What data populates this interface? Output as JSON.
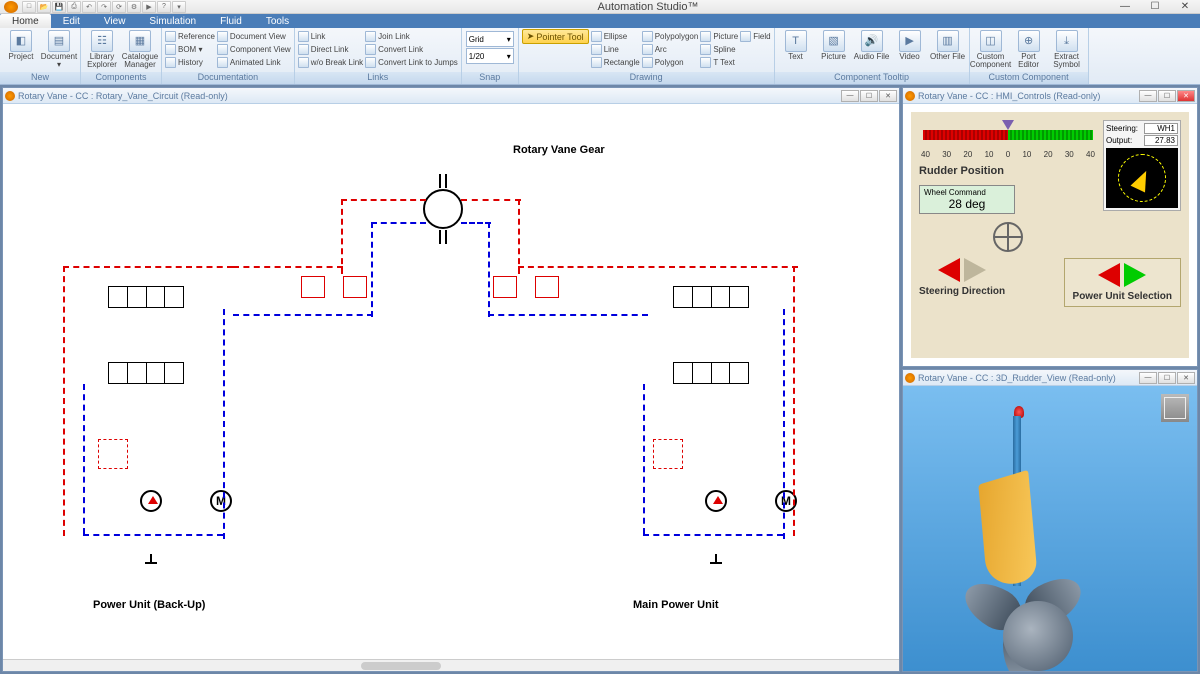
{
  "app": {
    "title": "Automation Studio™"
  },
  "qat_icons": [
    "file",
    "open",
    "save",
    "print",
    "undo",
    "redo",
    "sep",
    "refresh",
    "config",
    "play",
    "help",
    "expand"
  ],
  "menu_tabs": [
    "Home",
    "Edit",
    "View",
    "Simulation",
    "Fluid",
    "Tools"
  ],
  "menu_active": "Home",
  "ribbon": {
    "new": {
      "label": "New",
      "items": [
        "Project",
        "Document"
      ]
    },
    "components": {
      "label": "Components",
      "items": [
        "Library Explorer",
        "Catalogue Manager"
      ]
    },
    "documentation": {
      "label": "Documentation",
      "col1": [
        "Reference",
        "BOM ▾",
        "History"
      ],
      "col2": [
        "Document View",
        "Component View",
        "Animated Link"
      ]
    },
    "links": {
      "label": "Links",
      "col1": [
        "Link",
        "Direct Link",
        "w/o Break Link"
      ],
      "col2": [
        "Join Link",
        "Convert Link",
        "Convert Link to Jumps"
      ]
    },
    "snap": {
      "label": "Snap",
      "grid": "Grid",
      "grid_val": "1/20"
    },
    "drawing": {
      "label": "Drawing",
      "pointer": "Pointer Tool",
      "col1": [
        "Ellipse",
        "Line",
        "Rectangle"
      ],
      "col2": [
        "Polypolygon",
        "Arc",
        "Polygon"
      ],
      "col3": [
        "Picture",
        "Spline",
        "T Text"
      ],
      "col4": [
        "Field"
      ]
    },
    "tooltip": {
      "label": "Component Tooltip",
      "items": [
        "Text",
        "Picture",
        "Audio File",
        "Video",
        "Other File"
      ]
    },
    "custom": {
      "label": "Custom Component",
      "items": [
        "Custom Component",
        "Port Editor",
        "Extract Symbol"
      ]
    }
  },
  "circuit_window": {
    "title": "Rotary Vane - CC : Rotary_Vane_Circuit (Read-only)",
    "labels": {
      "title": "Rotary Vane Gear",
      "left_unit": "Power Unit (Back-Up)",
      "right_unit": "Main Power Unit"
    }
  },
  "hmi_window": {
    "title": "Rotary Vane - CC : HMI_Controls (Read-only)",
    "rudder": {
      "label": "Rudder Position",
      "ticks": [
        "40",
        "30",
        "20",
        "10",
        "0",
        "10",
        "20",
        "30",
        "40"
      ]
    },
    "compass": {
      "steering_label": "Steering:",
      "steering_val": "WH1",
      "output_label": "Output:",
      "output_val": "27.83"
    },
    "wheel_cmd": {
      "label": "Wheel Command",
      "value": "28",
      "unit": "deg"
    },
    "steering_dir_label": "Steering Direction",
    "power_sel_label": "Power Unit Selection"
  },
  "view3d_window": {
    "title": "Rotary Vane - CC : 3D_Rudder_View (Read-only)"
  }
}
